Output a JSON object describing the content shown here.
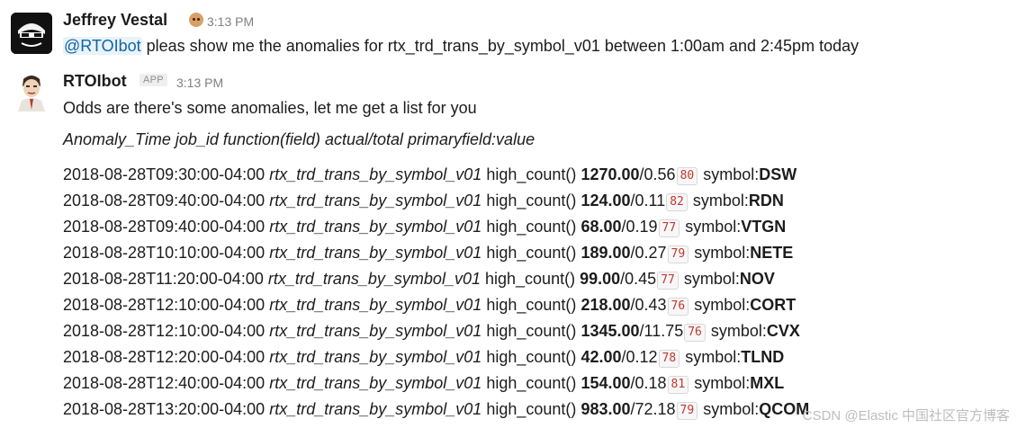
{
  "message1": {
    "author": "Jeffrey Vestal",
    "time": "3:13 PM",
    "mention": "@RTOIbot",
    "text": " pleas show me the anomalies for rtx_trd_trans_by_symbol_v01 between 1:00am and 2:45pm today"
  },
  "message2": {
    "author": "RTOIbot",
    "badge": "APP",
    "time": "3:13 PM",
    "text": "Odds are there's some anomalies, let me get a list for you",
    "header": "Anomaly_Time job_id function(field) actual/total primaryfield:value",
    "rows": [
      {
        "time": "2018-08-28T09:30:00-04:00",
        "job": "rtx_trd_trans_by_symbol_v01",
        "func": "high_count()",
        "actual": "1270.00",
        "typical": "/0.56",
        "score": "80",
        "field": "symbol:",
        "value": "DSW"
      },
      {
        "time": "2018-08-28T09:40:00-04:00",
        "job": "rtx_trd_trans_by_symbol_v01",
        "func": "high_count()",
        "actual": "124.00",
        "typical": "/0.11",
        "score": "82",
        "field": "symbol:",
        "value": "RDN"
      },
      {
        "time": "2018-08-28T09:40:00-04:00",
        "job": "rtx_trd_trans_by_symbol_v01",
        "func": "high_count()",
        "actual": "68.00",
        "typical": "/0.19",
        "score": "77",
        "field": "symbol:",
        "value": "VTGN"
      },
      {
        "time": "2018-08-28T10:10:00-04:00",
        "job": "rtx_trd_trans_by_symbol_v01",
        "func": "high_count()",
        "actual": "189.00",
        "typical": "/0.27",
        "score": "79",
        "field": "symbol:",
        "value": "NETE"
      },
      {
        "time": "2018-08-28T11:20:00-04:00",
        "job": "rtx_trd_trans_by_symbol_v01",
        "func": "high_count()",
        "actual": "99.00",
        "typical": "/0.45",
        "score": "77",
        "field": "symbol:",
        "value": "NOV"
      },
      {
        "time": "2018-08-28T12:10:00-04:00",
        "job": "rtx_trd_trans_by_symbol_v01",
        "func": "high_count()",
        "actual": "218.00",
        "typical": "/0.43",
        "score": "76",
        "field": "symbol:",
        "value": "CORT"
      },
      {
        "time": "2018-08-28T12:10:00-04:00",
        "job": "rtx_trd_trans_by_symbol_v01",
        "func": "high_count()",
        "actual": "1345.00",
        "typical": "/11.75",
        "score": "76",
        "field": "symbol:",
        "value": "CVX"
      },
      {
        "time": "2018-08-28T12:20:00-04:00",
        "job": "rtx_trd_trans_by_symbol_v01",
        "func": "high_count()",
        "actual": "42.00",
        "typical": "/0.12",
        "score": "78",
        "field": "symbol:",
        "value": "TLND"
      },
      {
        "time": "2018-08-28T12:40:00-04:00",
        "job": "rtx_trd_trans_by_symbol_v01",
        "func": "high_count()",
        "actual": "154.00",
        "typical": "/0.18",
        "score": "81",
        "field": "symbol:",
        "value": "MXL"
      },
      {
        "time": "2018-08-28T13:20:00-04:00",
        "job": "rtx_trd_trans_by_symbol_v01",
        "func": "high_count()",
        "actual": "983.00",
        "typical": "/72.18",
        "score": "79",
        "field": "symbol:",
        "value": "QCOM"
      }
    ]
  },
  "watermark": "CSDN @Elastic 中国社区官方博客"
}
